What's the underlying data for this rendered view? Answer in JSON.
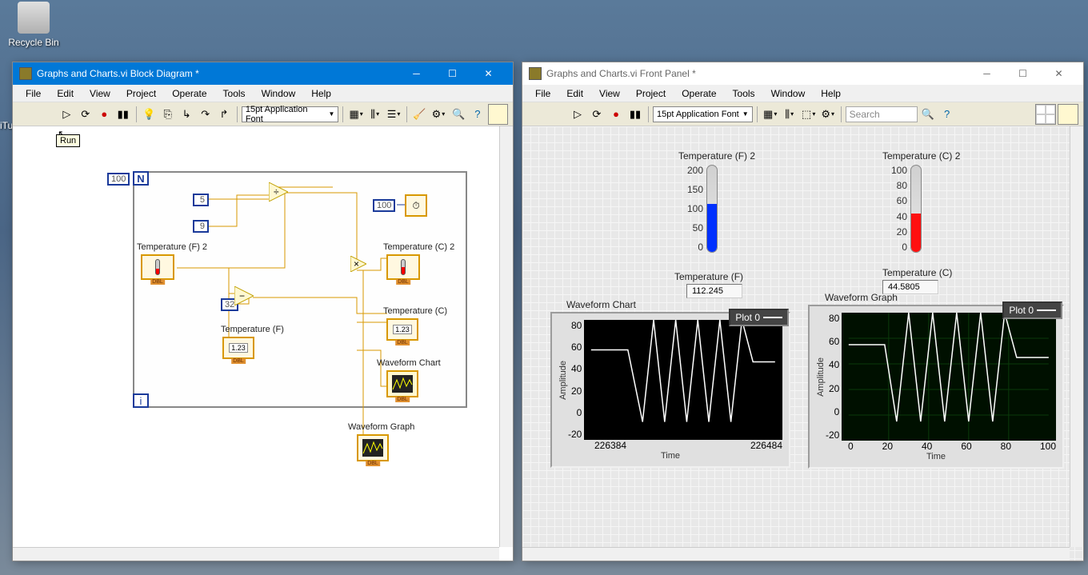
{
  "desktop": {
    "recycle_bin": "Recycle Bin",
    "itunes_fragment": "iTu"
  },
  "bd_window": {
    "title": "Graphs and Charts.vi Block Diagram *",
    "menu": [
      "File",
      "Edit",
      "View",
      "Project",
      "Operate",
      "Tools",
      "Window",
      "Help"
    ],
    "font": "15pt Application Font",
    "run_tooltip": "Run",
    "loop_n_const": "100",
    "const_5": "5",
    "const_9": "9",
    "const_32": "32",
    "const_100_wait": "100",
    "labels": {
      "temp_f2": "Temperature (F) 2",
      "temp_c2": "Temperature (C) 2",
      "temp_f": "Temperature (F)",
      "temp_c": "Temperature (C)",
      "wfm_chart": "Waveform Chart",
      "wfm_graph": "Waveform Graph"
    },
    "node_123": "1.23",
    "node_dbl": "DBL"
  },
  "fp_window": {
    "title": "Graphs and Charts.vi Front Panel *",
    "menu": [
      "File",
      "Edit",
      "View",
      "Project",
      "Operate",
      "Tools",
      "Window",
      "Help"
    ],
    "font": "15pt Application Font",
    "search_placeholder": "Search",
    "temp_f2": {
      "label": "Temperature (F) 2",
      "ticks": [
        "200",
        "150",
        "100",
        "50",
        "0"
      ],
      "fill_pct": 56
    },
    "temp_c2": {
      "label": "Temperature (C) 2",
      "ticks": [
        "100",
        "80",
        "60",
        "40",
        "20",
        "0"
      ],
      "fill_pct": 44
    },
    "temp_f": {
      "label": "Temperature (F)",
      "value": "112.245"
    },
    "temp_c": {
      "label": "Temperature (C)",
      "value": "44.5805"
    },
    "chart": {
      "title": "Waveform Chart",
      "legend": "Plot 0",
      "xlabel": "Time",
      "ylabel": "Amplitude",
      "yticks": [
        "80",
        "60",
        "40",
        "20",
        "0",
        "-20"
      ],
      "xticks": [
        "226384",
        "226484"
      ]
    },
    "graph": {
      "title": "Waveform Graph",
      "legend": "Plot 0",
      "xlabel": "Time",
      "ylabel": "Amplitude",
      "yticks": [
        "80",
        "60",
        "40",
        "20",
        "0",
        "-20"
      ],
      "xticks": [
        "0",
        "20",
        "40",
        "60",
        "80",
        "100"
      ]
    }
  },
  "chart_data": [
    {
      "type": "line",
      "title": "Waveform Chart",
      "xlabel": "Time",
      "ylabel": "Amplitude",
      "xlim": [
        226384,
        226484
      ],
      "ylim": [
        -20,
        80
      ],
      "x": [
        226384,
        226394,
        226404,
        226412,
        226418,
        226424,
        226430,
        226436,
        226442,
        226448,
        226454,
        226460,
        226466,
        226472,
        226478,
        226484
      ],
      "values": [
        55,
        55,
        55,
        -5,
        80,
        -5,
        80,
        -5,
        80,
        -5,
        80,
        -5,
        80,
        45,
        45,
        45
      ]
    },
    {
      "type": "line",
      "title": "Waveform Graph",
      "xlabel": "Time",
      "ylabel": "Amplitude",
      "xlim": [
        0,
        100
      ],
      "ylim": [
        -20,
        80
      ],
      "x": [
        0,
        10,
        18,
        24,
        30,
        36,
        42,
        48,
        54,
        60,
        66,
        72,
        78,
        84,
        90,
        100
      ],
      "values": [
        55,
        55,
        55,
        -5,
        80,
        -5,
        80,
        -5,
        80,
        -5,
        80,
        -5,
        80,
        45,
        45,
        45
      ]
    }
  ]
}
